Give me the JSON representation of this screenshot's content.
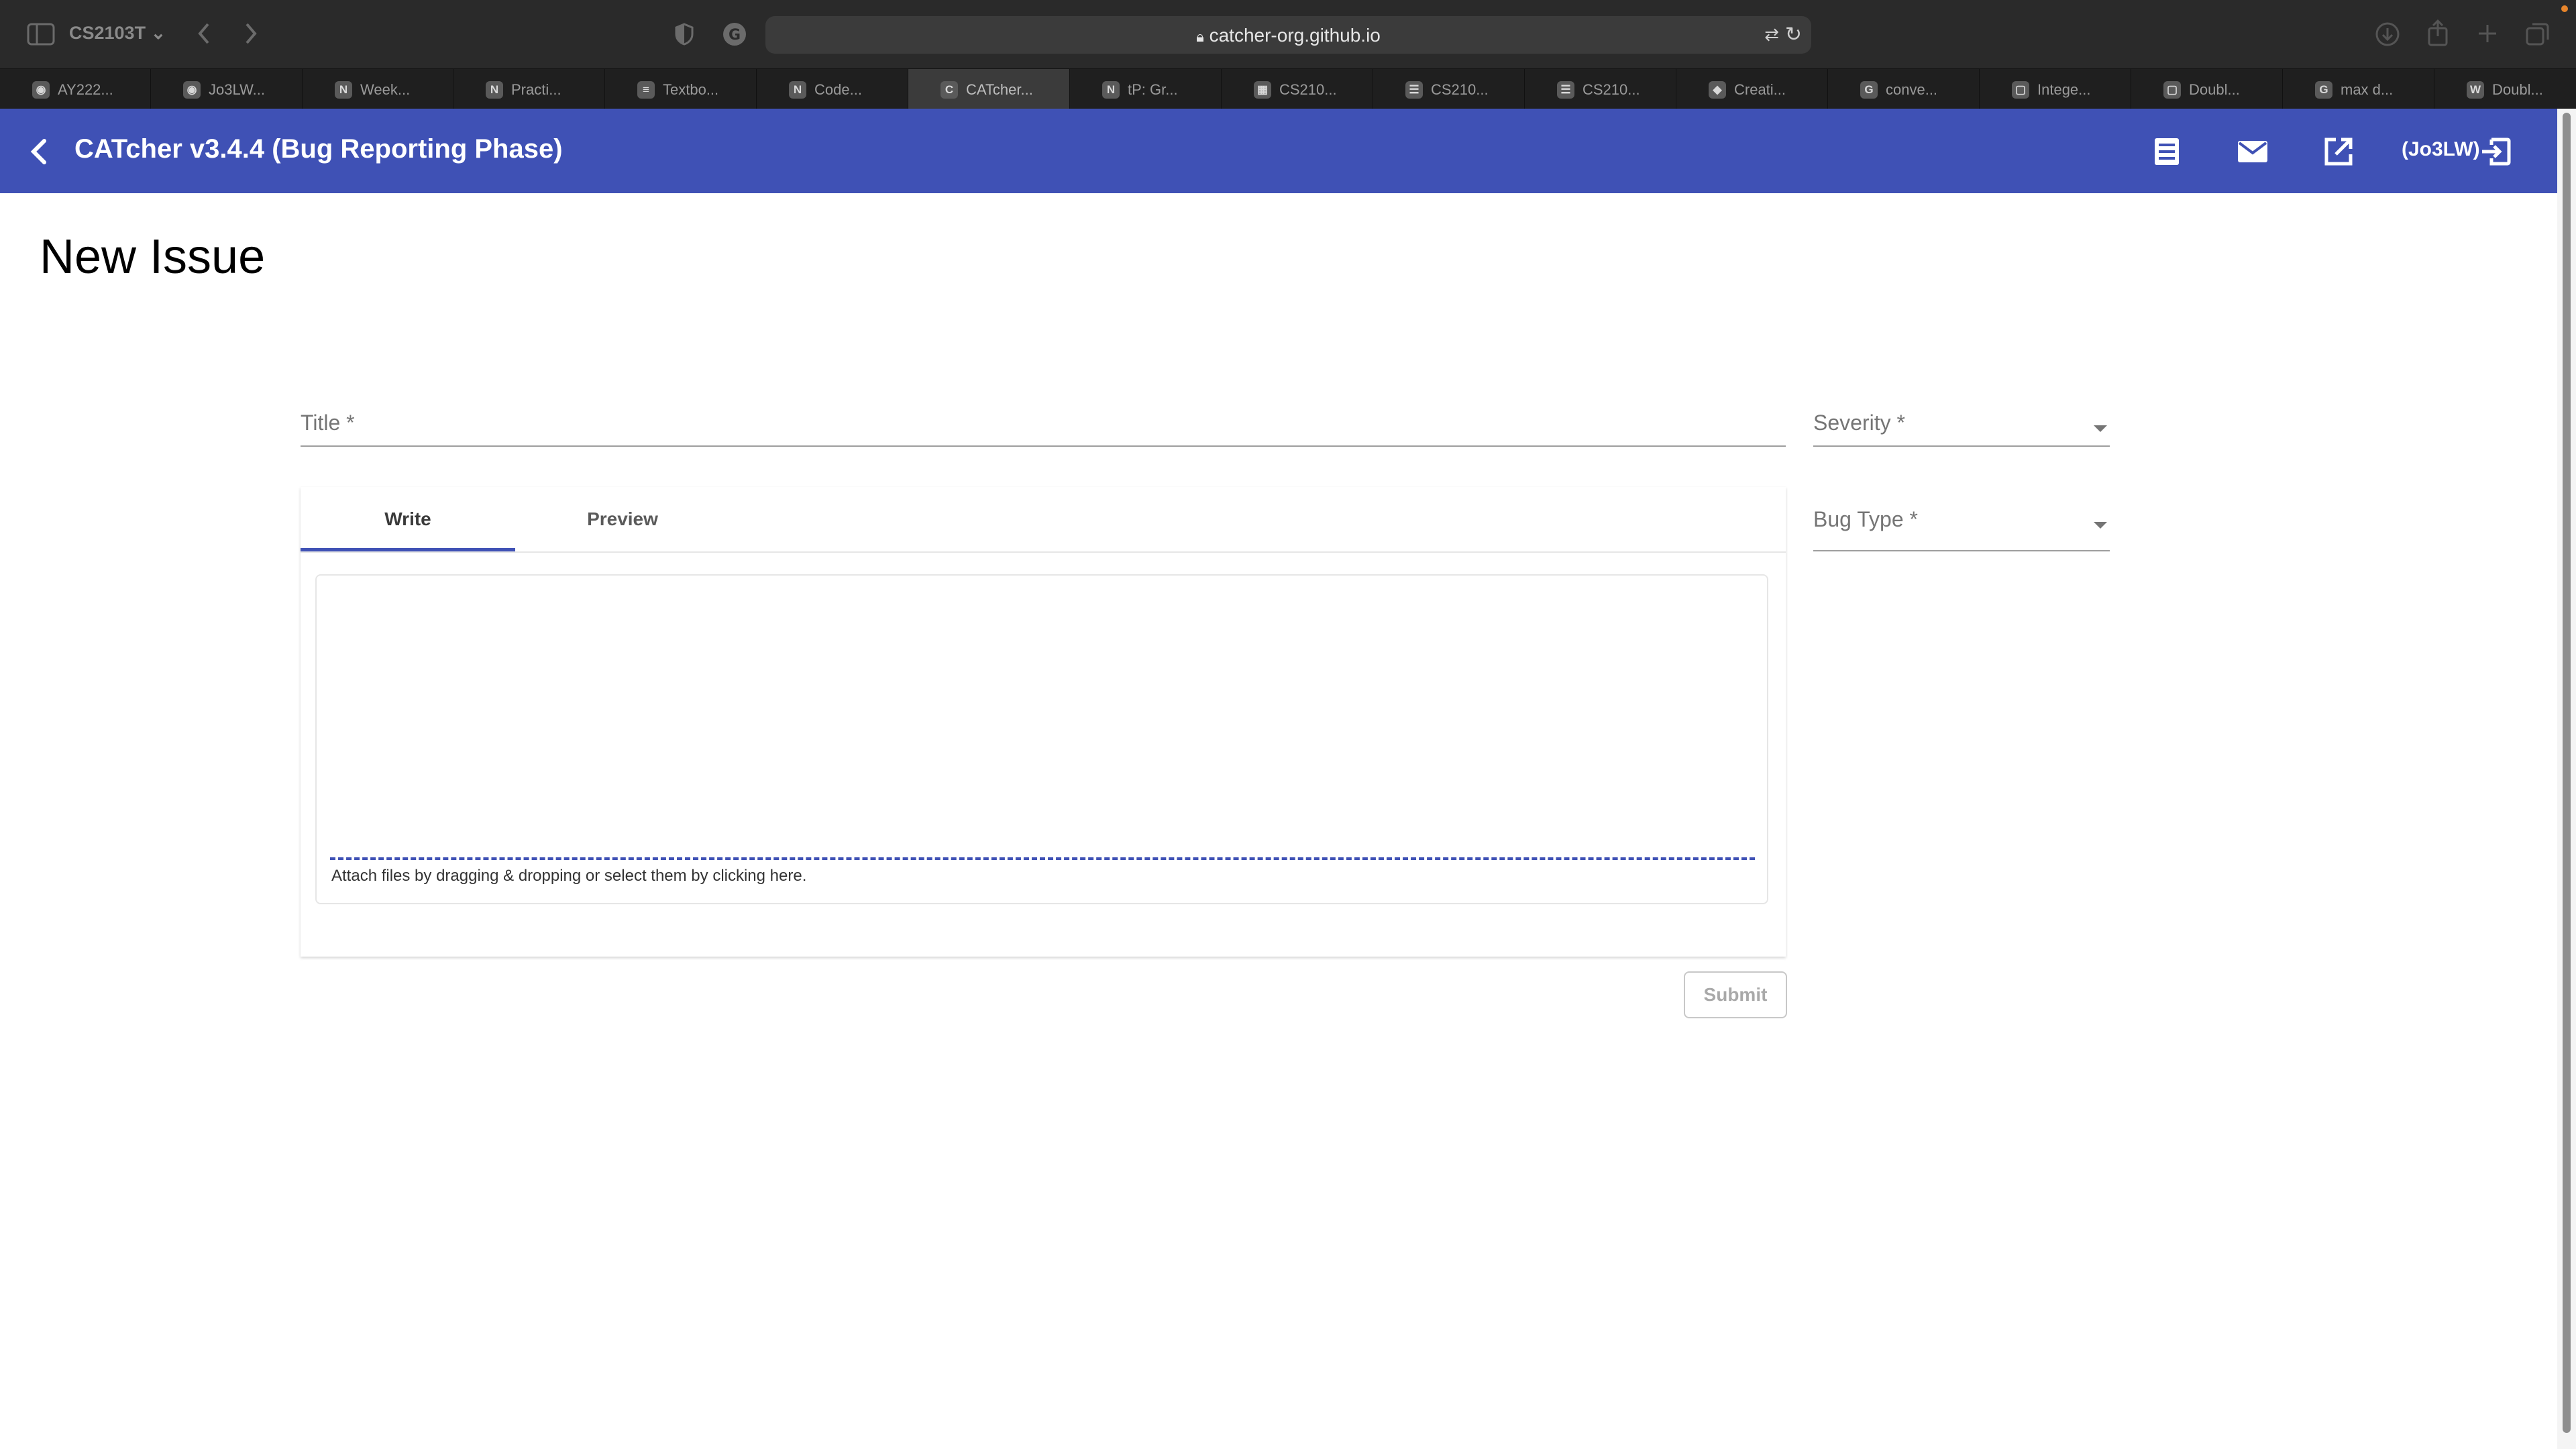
{
  "browser": {
    "tab_group": "CS2103T",
    "address": "catcher-org.github.io",
    "tabs": [
      {
        "label": "AY222...",
        "favicon": "github-icon",
        "active": false
      },
      {
        "label": "Jo3LW...",
        "favicon": "github-icon",
        "active": false
      },
      {
        "label": "Week...",
        "favicon": "notion-icon",
        "active": false
      },
      {
        "label": "Practi...",
        "favicon": "notion-icon",
        "active": false
      },
      {
        "label": "Textbo...",
        "favicon": "graduation-cap-icon",
        "active": false
      },
      {
        "label": "Code...",
        "favicon": "notion-icon",
        "active": false
      },
      {
        "label": "CATcher...",
        "favicon": "catcher-icon",
        "active": true
      },
      {
        "label": "tP: Gr...",
        "favicon": "notion-icon",
        "active": false
      },
      {
        "label": "CS210...",
        "favicon": "grid-icon",
        "active": false
      },
      {
        "label": "CS210...",
        "favicon": "doc-icon",
        "active": false
      },
      {
        "label": "CS210...",
        "favicon": "doc-icon",
        "active": false
      },
      {
        "label": "Creati...",
        "favicon": "leaf-icon",
        "active": false
      },
      {
        "label": "conve...",
        "favicon": "google-icon",
        "active": false
      },
      {
        "label": "Intege...",
        "favicon": "leetcode-icon",
        "active": false
      },
      {
        "label": "Doubl...",
        "favicon": "leetcode-icon",
        "active": false
      },
      {
        "label": "max d...",
        "favicon": "google-icon",
        "active": false
      },
      {
        "label": "Doubl...",
        "favicon": "wikipedia-icon",
        "active": false
      }
    ]
  },
  "header": {
    "title": "CATcher v3.4.4  (Bug Reporting Phase)",
    "user": "(Jo3LW)",
    "accent": "#3f51b5"
  },
  "page": {
    "title": "New Issue"
  },
  "form": {
    "title_label": "Title *",
    "severity_label": "Severity *",
    "bug_type_label": "Bug Type *",
    "tab_write": "Write",
    "tab_preview": "Preview",
    "attach_hint": "Attach files by dragging & dropping or select them by clicking here.",
    "submit_label": "Submit"
  }
}
